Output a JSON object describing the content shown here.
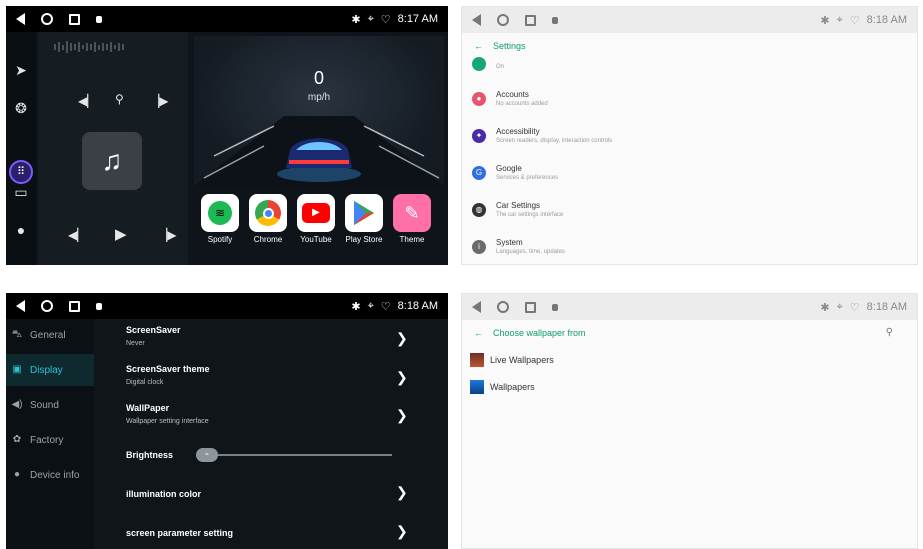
{
  "home": {
    "time": "8:17 AM",
    "speed": "0",
    "speed_unit": "mp/h",
    "apps": [
      {
        "label": "Spotify",
        "icon": "spotify-icon",
        "color": "#1db954"
      },
      {
        "label": "Chrome",
        "icon": "chrome-icon",
        "color": "#ea4335"
      },
      {
        "label": "YouTube",
        "icon": "youtube-icon",
        "color": "#ff0000"
      },
      {
        "label": "Play Store",
        "icon": "play-store-icon",
        "color": "#01875f"
      },
      {
        "label": "Theme",
        "icon": "theme-icon",
        "color": "#ff6fa8"
      }
    ]
  },
  "settings": {
    "time": "8:18 AM",
    "title": "Settings",
    "partial_subtitle": "On",
    "items": [
      {
        "title": "Accounts",
        "subtitle": "No accounts added",
        "icon": "accounts-icon",
        "color": "#e7546f"
      },
      {
        "title": "Accessibility",
        "subtitle": "Screen readers, display, interaction controls",
        "icon": "accessibility-icon",
        "color": "#4b2aa8"
      },
      {
        "title": "Google",
        "subtitle": "Services & preferences",
        "icon": "google-icon",
        "color": "#2f6fe0"
      },
      {
        "title": "Car Settings",
        "subtitle": "The car settings interface",
        "icon": "car-settings-icon",
        "color": "#333333"
      },
      {
        "title": "System",
        "subtitle": "Languages, time, updates",
        "icon": "system-icon",
        "color": "#6b6b6b"
      }
    ]
  },
  "display": {
    "time": "8:18 AM",
    "sidebar": [
      {
        "label": "General",
        "icon": "car-icon"
      },
      {
        "label": "Display",
        "icon": "display-icon"
      },
      {
        "label": "Sound",
        "icon": "speaker-icon"
      },
      {
        "label": "Factory",
        "icon": "gear-icon"
      },
      {
        "label": "Device info",
        "icon": "info-icon"
      }
    ],
    "options": [
      {
        "title": "ScreenSaver",
        "subtitle": "Never"
      },
      {
        "title": "ScreenSaver theme",
        "subtitle": "Digital clock"
      },
      {
        "title": "WallPaper",
        "subtitle": "Wallpaper setting interface"
      }
    ],
    "brightness_label": "Brightness",
    "illumination_label": "illumination color",
    "screen_param_label": "screen parameter setting"
  },
  "wallpaper": {
    "time": "8:18 AM",
    "title": "Choose wallpaper from",
    "items": [
      {
        "label": "Live Wallpapers"
      },
      {
        "label": "Wallpapers"
      }
    ]
  }
}
